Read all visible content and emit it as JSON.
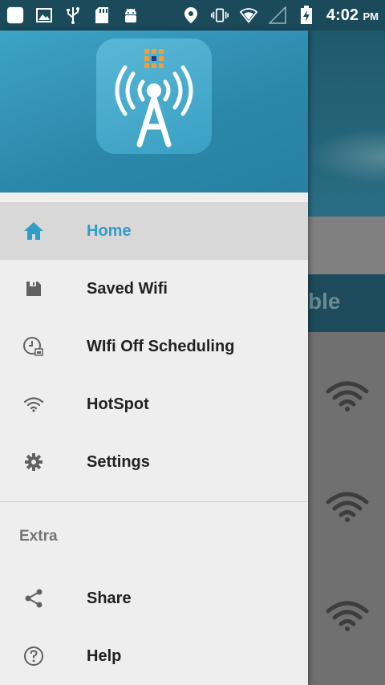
{
  "status_bar": {
    "time": "4:02",
    "ampm": "PM",
    "left_icons": [
      "app-square-icon",
      "image-icon",
      "usb-icon",
      "sd-card-icon",
      "android-icon"
    ],
    "right_icons": [
      "location-icon",
      "vibrate-icon",
      "wifi-signal-icon",
      "cell-signal-icon",
      "battery-charging-icon"
    ]
  },
  "background": {
    "banner_text": "ble"
  },
  "drawer": {
    "header": {
      "logo_icon": "wifi-tower-logo-icon"
    },
    "items": [
      {
        "label": "Home",
        "icon": "home-icon",
        "active": true
      },
      {
        "label": "Saved Wifi",
        "icon": "save-icon",
        "active": false
      },
      {
        "label": "WIfi Off Scheduling",
        "icon": "schedule-clock-icon",
        "active": false
      },
      {
        "label": "HotSpot",
        "icon": "wifi-icon",
        "active": false
      },
      {
        "label": "Settings",
        "icon": "gear-icon",
        "active": false
      }
    ],
    "extra_section": {
      "title": "Extra",
      "items": [
        {
          "label": "Share",
          "icon": "share-icon"
        },
        {
          "label": "Help",
          "icon": "help-icon"
        }
      ]
    }
  },
  "colors": {
    "accent": "#2f9dc7",
    "header": "#2b87aa",
    "status_bar": "#1b4a5a",
    "active_bg": "#d8d8d8",
    "icon_gray": "#616161"
  }
}
